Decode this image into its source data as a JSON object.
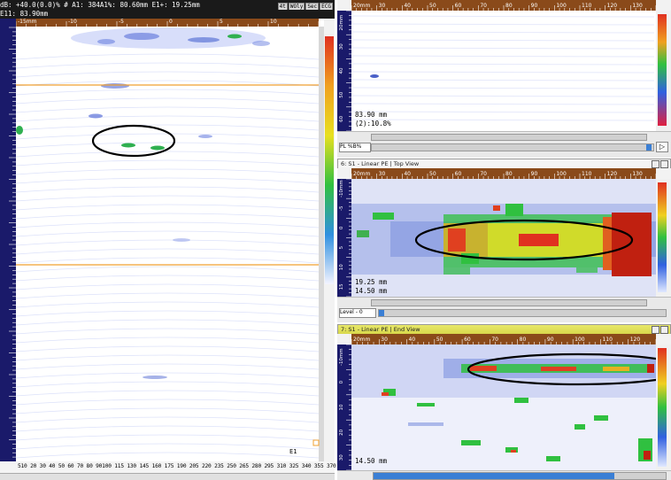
{
  "left_panel": {
    "header_line1": "dB: +40.0(0.0)%  # A1: 384A1%: 80.60mm  E1+: 19.25mm",
    "header_line2": "E11: 83.90mm",
    "toolbar_buttons": [
      "4t",
      "WOly",
      "Sec",
      "ECG"
    ],
    "bottom_axis": "510 20 30 40 50 60 70 80 90100 115 130 145 160 175 190 205 220 235 250 265 280 295 310 325 340 355 370",
    "cursor_label": "E1",
    "top_ruler": [
      "-15mm",
      "-10",
      "-5",
      "0",
      "5",
      "10"
    ],
    "overlay_color": "#f0a030"
  },
  "panel_top": {
    "ruler": [
      "20mm",
      "30",
      "40",
      "50",
      "60",
      "70",
      "80",
      "90",
      "100",
      "110",
      "120",
      "130"
    ],
    "side_ruler": [
      "20mm",
      "30",
      "40",
      "50",
      "60"
    ],
    "depth_text": "83.90 mm",
    "val_text": "(2):10.8%",
    "select_label": "PL %B%"
  },
  "panel_mid": {
    "title": "6: S1 - Linear PE | Top View",
    "ruler": [
      "20mm",
      "30",
      "40",
      "50",
      "60",
      "70",
      "80",
      "90",
      "100",
      "110",
      "120",
      "130"
    ],
    "side_ruler": [
      "-10mm",
      "-5",
      "0",
      "5",
      "10",
      "15"
    ],
    "depth_text": "19.25 mm",
    "val_text": "14.50 mm",
    "select_label": "Level - 0"
  },
  "panel_bot": {
    "title": "7: S1 - Linear PE | End View",
    "ruler": [
      "20mm",
      "30",
      "40",
      "50",
      "60",
      "70",
      "80",
      "90",
      "100",
      "110",
      "120"
    ],
    "side_ruler": [
      "-10mm",
      "0",
      "10",
      "20",
      "30"
    ],
    "depth_text": "14.50 mm"
  },
  "colors": {
    "ruler_bg": "#8a4a1a",
    "ruler_text": "#ffffff",
    "navy": "#1a1a6a",
    "scan_low": "#eef2ff",
    "scan_med": "#7080e0",
    "scan_high": "#20c040",
    "scan_peak": "#e03020"
  }
}
